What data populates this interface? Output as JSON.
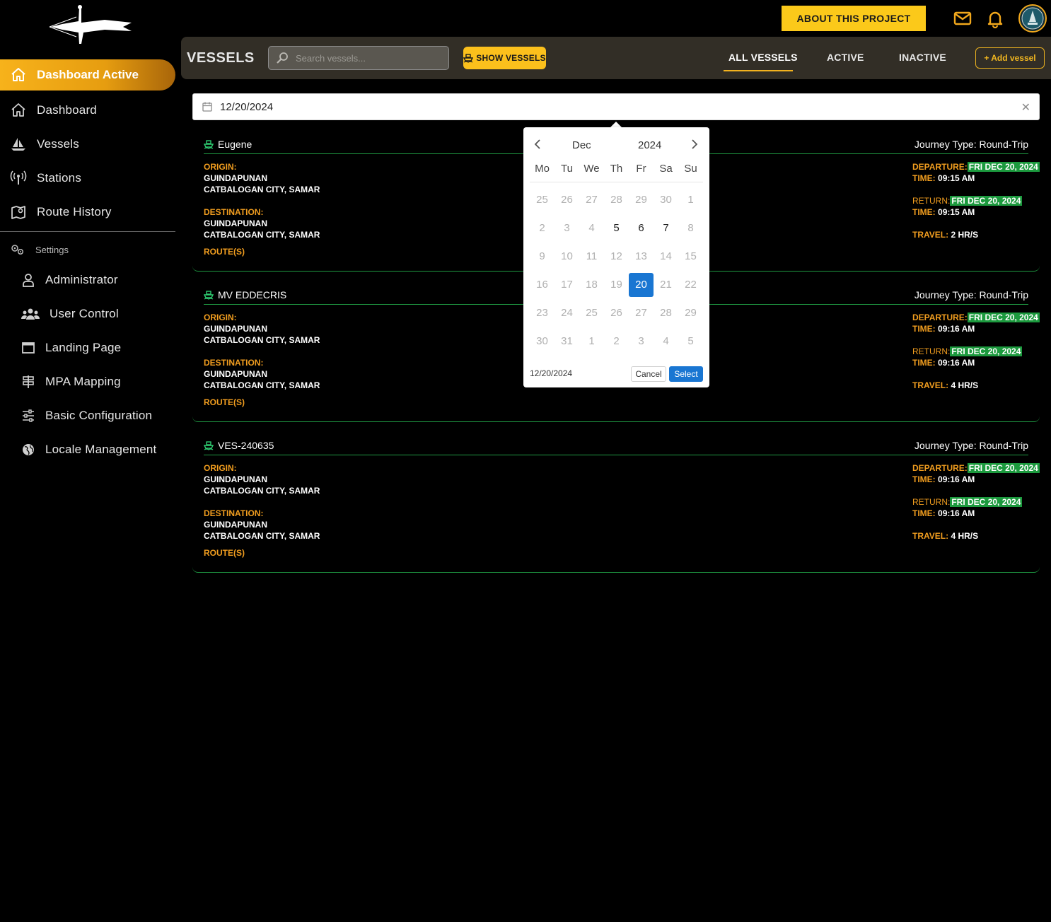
{
  "sidebar": {
    "active_item": "Dashboard Active",
    "items": [
      {
        "label": "Dashboard",
        "icon": "home-icon"
      },
      {
        "label": "Vessels",
        "icon": "sailboat-icon"
      },
      {
        "label": "Stations",
        "icon": "antenna-icon"
      },
      {
        "label": "Route History",
        "icon": "map-pin-icon"
      }
    ],
    "settings_label": "Settings",
    "settings_items": [
      {
        "label": "Administrator",
        "icon": "user-icon"
      },
      {
        "label": "User Control",
        "icon": "users-icon"
      },
      {
        "label": "Landing Page",
        "icon": "window-icon"
      },
      {
        "label": "MPA Mapping",
        "icon": "signpost-icon"
      },
      {
        "label": "Basic Configuration",
        "icon": "sliders-icon"
      },
      {
        "label": "Locale Management",
        "icon": "globe-icon"
      }
    ]
  },
  "topbar": {
    "about_label": "ABOUT THIS PROJECT"
  },
  "header": {
    "title": "VESSELS",
    "search_placeholder": "Search vessels...",
    "show_label": "SHOW VESSELS",
    "tabs": [
      "ALL VESSELS",
      "ACTIVE",
      "INACTIVE"
    ],
    "active_tab": "ALL VESSELS",
    "add_label": "+ Add vessel"
  },
  "date_filter": {
    "value": "12/20/2024"
  },
  "labels": {
    "origin": "ORIGIN:",
    "destination": "DESTINATION:",
    "routes": "ROUTE(S)",
    "departure": "DEPARTURE:",
    "return": "RETURN:",
    "time": "TIME:",
    "travel": "TRAVEL:"
  },
  "vessels": [
    {
      "name": "Eugene",
      "journey": "Journey Type: Round-Trip",
      "origin": [
        "GUINDAPUNAN",
        "CATBALOGAN CITY, SAMAR"
      ],
      "destination": [
        "GUINDAPUNAN",
        "CATBALOGAN CITY, SAMAR"
      ],
      "departure_date": "FRI DEC 20, 2024",
      "departure_time": "09:15 AM",
      "return_date": "FRI DEC 20, 2024",
      "return_time": "09:15 AM",
      "travel": "2 HR/S"
    },
    {
      "name": "MV EDDECRIS",
      "journey": "Journey Type: Round-Trip",
      "origin": [
        "GUINDAPUNAN",
        "CATBALOGAN CITY, SAMAR"
      ],
      "destination": [
        "GUINDAPUNAN",
        "CATBALOGAN CITY, SAMAR"
      ],
      "departure_date": "FRI DEC 20, 2024",
      "departure_time": "09:16 AM",
      "return_date": "FRI DEC 20, 2024",
      "return_time": "09:16 AM",
      "travel": "4 HR/S"
    },
    {
      "name": "VES-240635",
      "journey": "Journey Type: Round-Trip",
      "origin": [
        "GUINDAPUNAN",
        "CATBALOGAN CITY, SAMAR"
      ],
      "destination": [
        "GUINDAPUNAN",
        "CATBALOGAN CITY, SAMAR"
      ],
      "departure_date": "FRI DEC 20, 2024",
      "departure_time": "09:16 AM",
      "return_date": "FRI DEC 20, 2024",
      "return_time": "09:16 AM",
      "travel": "4 HR/S"
    }
  ],
  "calendar": {
    "month": "Dec",
    "year": "2024",
    "weekdays": [
      "Mo",
      "Tu",
      "We",
      "Th",
      "Fr",
      "Sa",
      "Su"
    ],
    "weeks": [
      [
        "25",
        "26",
        "27",
        "28",
        "29",
        "30",
        "1"
      ],
      [
        "2",
        "3",
        "4",
        "5",
        "6",
        "7",
        "8"
      ],
      [
        "9",
        "10",
        "11",
        "12",
        "13",
        "14",
        "15"
      ],
      [
        "16",
        "17",
        "18",
        "19",
        "20",
        "21",
        "22"
      ],
      [
        "23",
        "24",
        "25",
        "26",
        "27",
        "28",
        "29"
      ],
      [
        "30",
        "31",
        "1",
        "2",
        "3",
        "4",
        "5"
      ]
    ],
    "enabled_days": [
      "5",
      "6",
      "7",
      "20"
    ],
    "selected_day": "20",
    "footer_value": "12/20/2024",
    "cancel_label": "Cancel",
    "select_label": "Select"
  },
  "colors": {
    "accent": "#fbc91a",
    "label_orange": "#f29e1f",
    "highlight_green": "#1c9a3e",
    "calendar_selected": "#1976d2"
  }
}
